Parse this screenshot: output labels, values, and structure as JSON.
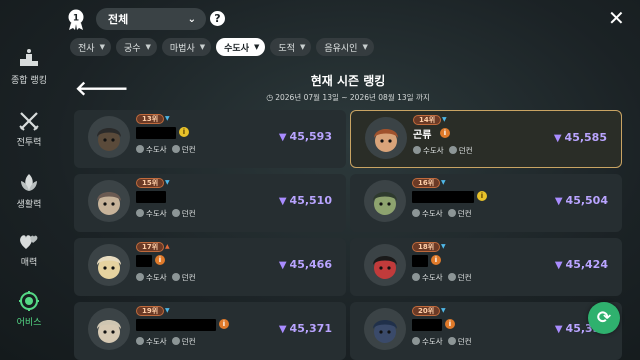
{
  "header": {
    "server_select": "전체",
    "title": "현재 시즌 랭킹",
    "period": "2026년 07월 13일 ~ 2026년 08월 13일 까지"
  },
  "sidebar": {
    "items": [
      {
        "label": "종합 랭킹",
        "icon": "podium-icon"
      },
      {
        "label": "전투력",
        "icon": "swords-icon"
      },
      {
        "label": "생활력",
        "icon": "leaf-icon"
      },
      {
        "label": "매력",
        "icon": "hearts-icon"
      },
      {
        "label": "어비스",
        "icon": "abyss-icon",
        "active": true
      }
    ]
  },
  "filters": {
    "chips": [
      {
        "label": "전사",
        "active": false
      },
      {
        "label": "궁수",
        "active": false
      },
      {
        "label": "마법사",
        "active": false
      },
      {
        "label": "수도사",
        "active": true
      },
      {
        "label": "도적",
        "active": false
      },
      {
        "label": "음유시인",
        "active": false
      }
    ]
  },
  "rankings": [
    {
      "rank": "13위",
      "trend": "down",
      "name": "",
      "lvl_badge": "gold",
      "class": "수도사",
      "server": "던컨",
      "score": "45,593",
      "highlight": false
    },
    {
      "rank": "14위",
      "trend": "down",
      "name": "곤류",
      "lvl_badge": "orange",
      "class": "수도사",
      "server": "던컨",
      "score": "45,585",
      "highlight": true
    },
    {
      "rank": "15위",
      "trend": "down",
      "name": "",
      "lvl_badge": "none",
      "class": "수도사",
      "server": "던컨",
      "score": "45,510",
      "highlight": false
    },
    {
      "rank": "16위",
      "trend": "down",
      "name": "",
      "lvl_badge": "gold",
      "class": "수도사",
      "server": "던컨",
      "score": "45,504",
      "highlight": false
    },
    {
      "rank": "17위",
      "trend": "up",
      "name": "",
      "lvl_badge": "orange",
      "class": "수도사",
      "server": "던컨",
      "score": "45,466",
      "highlight": false
    },
    {
      "rank": "18위",
      "trend": "down",
      "name": "",
      "lvl_badge": "orange",
      "class": "수도사",
      "server": "던컨",
      "score": "45,424",
      "highlight": false
    },
    {
      "rank": "19위",
      "trend": "down",
      "name": "",
      "lvl_badge": "orange",
      "class": "수도사",
      "server": "던컨",
      "score": "45,371",
      "highlight": false
    },
    {
      "rank": "20위",
      "trend": "down",
      "name": "",
      "lvl_badge": "orange",
      "class": "수도사",
      "server": "던컨",
      "score": "45,352",
      "highlight": false
    }
  ],
  "colors": {
    "accent_green": "#55d986",
    "score_purple": "#b9a4ff",
    "highlight_border": "#c9a463"
  }
}
